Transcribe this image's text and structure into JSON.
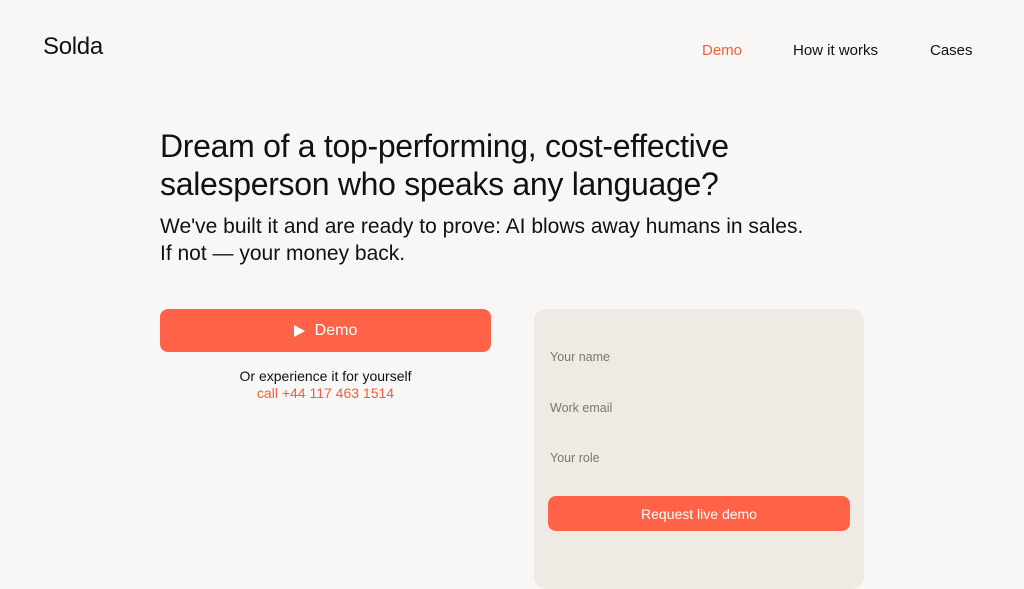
{
  "brand": {
    "logo_text": "Solda"
  },
  "nav": {
    "items": [
      {
        "label": "Demo"
      },
      {
        "label": "How it works"
      },
      {
        "label": "Cases"
      }
    ]
  },
  "hero": {
    "headline_line1": "Dream of a top-performing, cost-effective",
    "headline_line2": "salesperson who speaks any language?",
    "subline_line1": "We've built it and are ready to prove: AI blows away humans in sales.",
    "subline_line2": "If not — your money back.",
    "demo_button_label": "Demo",
    "alt_text": "Or experience it for yourself",
    "call_text": "call +44 117 463 1514"
  },
  "form": {
    "name_placeholder": "Your name",
    "email_placeholder": "Work email",
    "role_placeholder": "Your role",
    "submit_label": "Request live demo"
  },
  "colors": {
    "accent": "#ff6347",
    "accent_text": "#f0603f",
    "background": "#f8f7f5",
    "card": "#efebe4"
  },
  "icons": {
    "demo_button_icon": "play-icon"
  }
}
